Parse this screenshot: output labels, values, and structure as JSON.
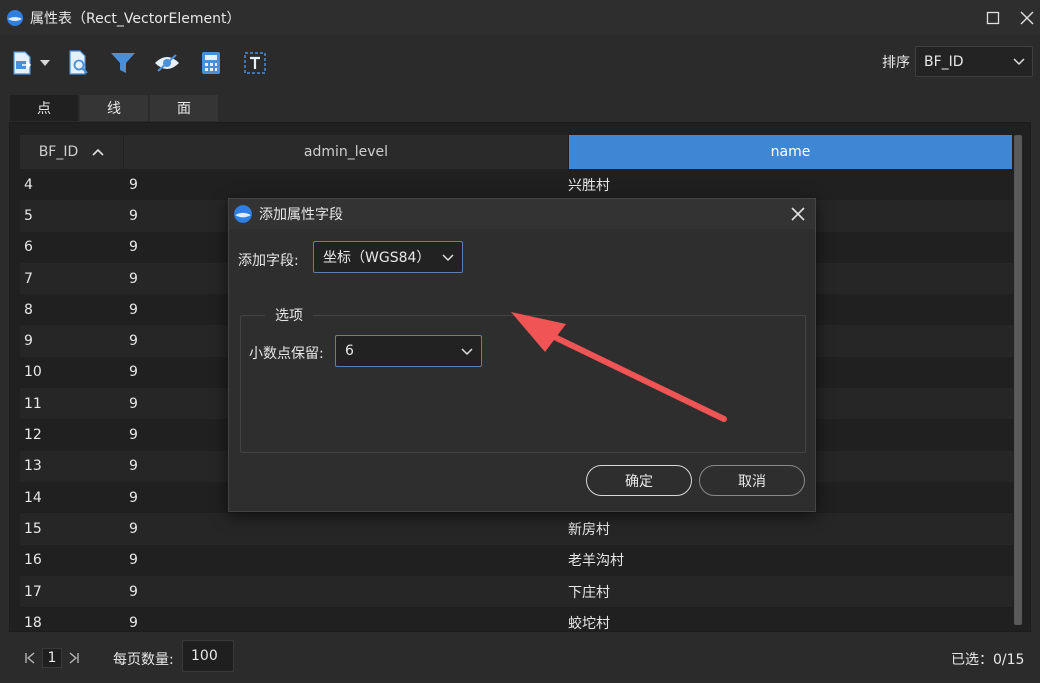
{
  "window": {
    "title": "属性表（Rect_VectorElement）"
  },
  "toolbar": {
    "icons": [
      "export-icon",
      "dropdown-icon",
      "search-document-icon",
      "filter-icon",
      "eye-hide-icon",
      "calculator-icon",
      "text-icon"
    ],
    "sort_label": "排序",
    "sort_value": "BF_ID"
  },
  "tabs": [
    {
      "label": "点",
      "active": true
    },
    {
      "label": "线",
      "active": false
    },
    {
      "label": "面",
      "active": false
    }
  ],
  "table": {
    "columns": [
      "BF_ID",
      "admin_level",
      "name"
    ],
    "sorted_column": "BF_ID",
    "sort_direction": "ascending",
    "selected_column": "name",
    "rows": [
      [
        "4",
        "9",
        "兴胜村"
      ],
      [
        "5",
        "9",
        ""
      ],
      [
        "6",
        "9",
        ""
      ],
      [
        "7",
        "9",
        ""
      ],
      [
        "8",
        "9",
        ""
      ],
      [
        "9",
        "9",
        ""
      ],
      [
        "10",
        "9",
        ""
      ],
      [
        "11",
        "9",
        ""
      ],
      [
        "12",
        "9",
        ""
      ],
      [
        "13",
        "9",
        ""
      ],
      [
        "14",
        "9",
        ""
      ],
      [
        "15",
        "9",
        "新房村"
      ],
      [
        "16",
        "9",
        "老羊沟村"
      ],
      [
        "17",
        "9",
        "下庄村"
      ],
      [
        "18",
        "9",
        "蛟坨村"
      ]
    ]
  },
  "footer": {
    "current_page": "1",
    "page_size_label": "每页数量:",
    "page_size": "100",
    "selected": "已选：0/15"
  },
  "dialog": {
    "title": "添加属性字段",
    "field_label": "添加字段:",
    "field_value": "坐标（WGS84）",
    "group_title": "选项",
    "decimal_label": "小数点保留:",
    "decimal_value": "6",
    "ok_label": "确定",
    "cancel_label": "取消"
  },
  "colors": {
    "accent": "#3f87d4",
    "background": "#2b2b2b",
    "annotation_arrow": "#f05454"
  }
}
